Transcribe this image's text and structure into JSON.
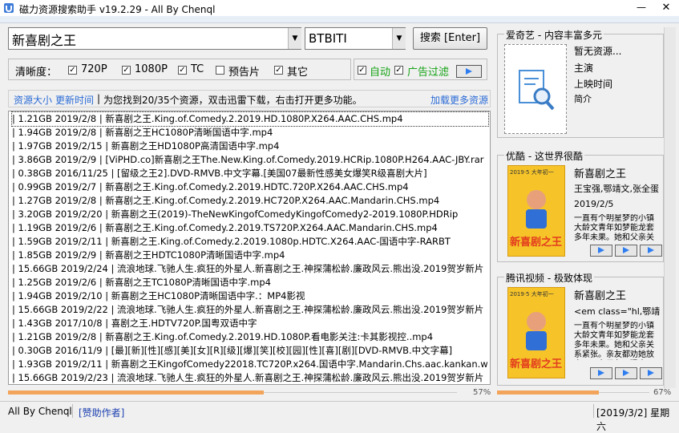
{
  "window": {
    "title": "磁力资源搜索助手 v19.2.29 - All By Chenql",
    "minimize": "—",
    "close": "✕"
  },
  "search": {
    "value": "新喜剧之王",
    "engine": "BTBITI",
    "button": "搜索 [Enter]"
  },
  "filters": {
    "label": "清晰度：",
    "options": [
      {
        "label": "720P",
        "checked": true
      },
      {
        "label": "1080P",
        "checked": true
      },
      {
        "label": "TC",
        "checked": true
      },
      {
        "label": "预告片",
        "checked": false
      },
      {
        "label": "其它",
        "checked": true
      }
    ],
    "auto": {
      "label": "自动",
      "checked": true
    },
    "ad_filter": {
      "label": "广告过滤",
      "checked": true
    }
  },
  "status": {
    "sort_size": "资源大小",
    "sort_time": "更新时间",
    "separator": "|",
    "message": "为您找到20/35个资源，双击迅雷下载，右击打开更多功能。",
    "load_more": "加载更多资源"
  },
  "results": [
    "| 1.21GB 2019/2/8 | 新喜剧之王.King.of.Comedy.2.2019.HD.1080P.X264.AAC.CHS.mp4",
    "| 1.94GB 2019/2/8 | 新喜剧之王HC1080P清晰国语中字.mp4",
    "| 1.97GB 2019/2/15 | 新喜剧之王HD1080P高清国语中字.mp4",
    "| 3.86GB 2019/2/9 | [ViPHD.co]新喜剧之王The.New.King.of.Comedy.2019.HCRip.1080P.H264.AAC-JBY.rar",
    "| 0.38GB 2016/11/25 | [留级之王2].DVD-RMVB.中文字幕.[美国07最新性感美女爆笑R级喜剧大片]",
    "| 0.99GB 2019/2/7 | 新喜剧之王.King.of.Comedy.2.2019.HDTC.720P.X264.AAC.CHS.mp4",
    "| 1.27GB 2019/2/8 | 新喜剧之王.King.of.Comedy.2.2019.HC720P.X264.AAC.Mandarin.CHS.mp4",
    "| 3.20GB 2019/2/20 | 新喜剧之王(2019)-TheNewKingofComedyKingofComedy2-2019.1080P.HDRip",
    "| 1.19GB 2019/2/6 | 新喜剧之王.King.of.Comedy.2.2019.TS720P.X264.AAC.Mandarin.CHS.mp4",
    "| 1.59GB 2019/2/11 | 新喜剧之王.King.of.Comedy.2.2019.1080p.HDTC.X264.AAC-国语中字-RARBT",
    "| 1.85GB 2019/2/9 | 新喜剧之王HDTC1080P清晰国语中字.mp4",
    "| 15.66GB 2019/2/24 | 流浪地球.飞驰人生.疯狂的外星人.新喜剧之王.神探蒲松龄.廉政风云.熊出没.2019贺岁新片",
    "| 1.25GB 2019/2/6 | 新喜剧之王TC1080P清晰国语中字.mp4",
    "| 1.94GB 2019/2/10 | 新喜剧之王HC1080P清晰国语中字.：MP4影视",
    "| 15.66GB 2019/2/22 | 流浪地球.飞驰人生.疯狂的外星人.新喜剧之王.神探蒲松龄.廉政风云.熊出没.2019贺岁新片",
    "| 1.43GB 2017/10/8 | 喜剧之王.HDTV720P.国粤双语中字",
    "| 1.21GB 2019/2/8 | 新喜剧之王.King.of.Comedy.2.2019.HD.1080P.看电影关注:卡其影视控..mp4",
    "| 0.30GB 2016/11/9 | [最][新][性][感][美][女][R][级][爆][笑][校][园][性][喜][剧][DVD-RMVB.中文字幕]",
    "| 1.93GB 2019/2/11 | 新喜剧之王KingofComedy22018.TC720P.x264.国语中字.Mandarin.Chs.aac.kankan.w",
    "| 15.66GB 2019/2/23 | 流浪地球.飞驰人生.疯狂的外星人.新喜剧之王.神探蒲松龄.廉政风云.熊出没.2019贺岁新片"
  ],
  "progress": {
    "left_value": 0.57,
    "left_label": "57%",
    "right_value": 0.67,
    "right_label": "67%"
  },
  "statusbar": {
    "author": "All By Chenql",
    "donate": "[赞助作者]",
    "date": "[2019/3/2] 星期六"
  },
  "panels": {
    "iqiyi": {
      "title": "爱奇艺 - 内容丰富多元",
      "name": "暂无资源...",
      "actors": "主演",
      "release": "上映时间",
      "summary": "简介"
    },
    "youku": {
      "title": "优酷 - 这世界很酷",
      "name": "新喜剧之王",
      "actors": "王宝强,鄂靖文,张全蛋",
      "release": "2019/2/5",
      "summary": "一直有个明星梦的小镇大龄文青年如梦能龙套多年未果。她和父亲关",
      "poster_title": "新喜剧之王",
      "poster_tag": "2019·5 大年初一"
    },
    "tencent": {
      "title": "腾讯视频 - 极致体现",
      "name": "新喜剧之王",
      "actors": "<em class=\"hl,鄂靖",
      "summary": "一直有个明星梦的小镇大龄文青年如梦能龙套多年未果。她和父亲关系紧张。亲友都劝她放弃，只有男友王猛支",
      "poster_title": "新喜剧之王",
      "poster_tag": "2019·5 大年初一"
    }
  },
  "colors": {
    "accent": "#2b6bd6",
    "progress": "#f2a45a",
    "poster": "#f6c429"
  }
}
